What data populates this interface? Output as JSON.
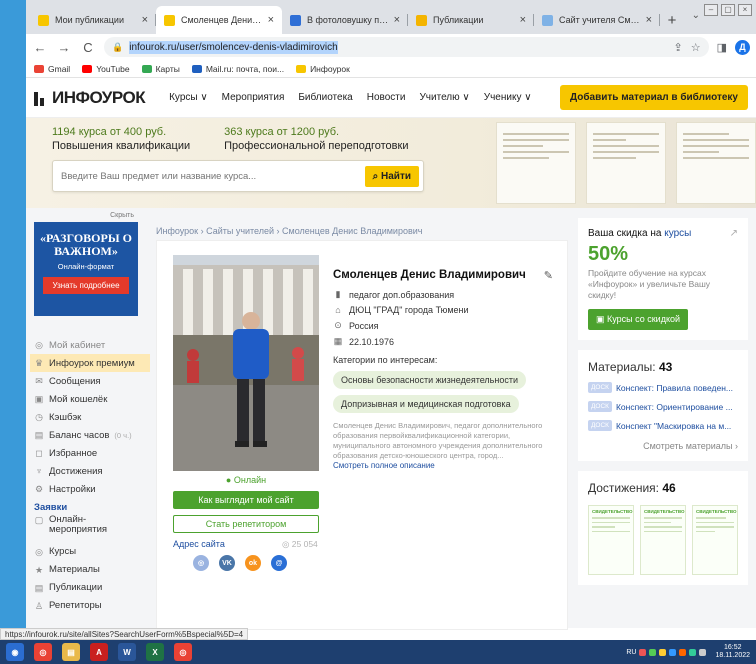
{
  "browser": {
    "tabs": [
      {
        "title": "Мои публикации",
        "color": "#f7c600",
        "active": false
      },
      {
        "title": "Смоленцев Денис Владимирович",
        "color": "#f7c600",
        "active": true
      },
      {
        "title": "В фотоловушку приморск",
        "color": "#2f6fd6",
        "active": false
      },
      {
        "title": "Публикации",
        "color": "#f4b400",
        "active": false
      },
      {
        "title": "Сайт учителя Смоленцев",
        "color": "#7fb2e6",
        "active": false
      }
    ],
    "new_tab": "+",
    "url": "infourok.ru/user/smolencev-denis-vladimirovich",
    "profile_initial": "Д",
    "bookmarks": [
      {
        "label": "Gmail",
        "color": "#ea4335"
      },
      {
        "label": "YouTube",
        "color": "#ff0000"
      },
      {
        "label": "Карты",
        "color": "#34a853"
      },
      {
        "label": "Mail.ru: почта, пои...",
        "color": "#1f5fbf"
      },
      {
        "label": "Инфоурок",
        "color": "#f7c600"
      }
    ]
  },
  "site": {
    "logo": "ИНФОУРОК",
    "nav": [
      "Курсы ∨",
      "Мероприятия",
      "Библиотека",
      "Новости",
      "Учителю ∨",
      "Ученику ∨"
    ],
    "add_button": "Добавить материал в библиотеку"
  },
  "banner": {
    "promo1_a": "1194 курса от 400 руб.",
    "promo1_b": "Повышения квалификации",
    "promo2_a": "363 курса от 1200 руб.",
    "promo2_b": "Профессиональной переподготовки",
    "search_placeholder": "Введите Ваш предмет или название курса...",
    "search_button": "⌕ Найти"
  },
  "ad": {
    "hide": "Скрыть",
    "title": "«РАЗГОВОРЫ О ВАЖНОМ»",
    "subtitle": "Онлайн-формат",
    "button": "Узнать подробнее"
  },
  "menu": {
    "items": [
      {
        "label": "Мой кабинет",
        "icon": "◎",
        "muted": true
      },
      {
        "label": "Инфоурок премиум",
        "icon": "♛",
        "premium": true
      },
      {
        "label": "Сообщения",
        "icon": "✉"
      },
      {
        "label": "Мой кошелёк",
        "icon": "▣"
      },
      {
        "label": "Кэшбэк",
        "icon": "◷"
      },
      {
        "label": "Баланс часов",
        "icon": "▤",
        "extra": "(0 ч.)"
      },
      {
        "label": "Избранное",
        "icon": "◻"
      },
      {
        "label": "Достижения",
        "icon": "♆"
      },
      {
        "label": "Настройки",
        "icon": "⚙"
      }
    ],
    "group": "Заявки",
    "group_items": [
      {
        "label": "Онлайн-мероприятия",
        "icon": "▢"
      },
      {
        "label": "Курсы",
        "icon": "◎"
      },
      {
        "label": "Материалы",
        "icon": "★"
      },
      {
        "label": "Публикации",
        "icon": "▤"
      },
      {
        "label": "Репетиторы",
        "icon": "♙"
      }
    ]
  },
  "breadcrumbs": "Инфоурок › Сайты учителей › Смоленцев Денис Владимирович",
  "profile": {
    "name": "Смоленцев Денис Владимирович",
    "position": "педагог доп.образования",
    "org": "ДЮЦ \"ГРАД\" города Тюмени",
    "country": "Россия",
    "birthday": "22.10.1976",
    "categories_label": "Категории по интересам:",
    "categories": [
      "Основы безопасности жизнедеятельности",
      "Допризывная и медицинская подготовка"
    ],
    "about": "Смоленцев Денис Владимирович, педагог дополнительного образования первойквалификационной категории, муниципального автономного учреждения дополнительного образования детско-юношеского центра, город...",
    "more_link": "Смотреть полное описание",
    "status": "● Онлайн",
    "btn_site": "Как выглядит мой сайт",
    "btn_tutor": "Стать репетитором",
    "site_address": "Адрес сайта",
    "views": "◎ 25 054"
  },
  "discount": {
    "heading": "Ваша скидка на",
    "heading_link": "курсы",
    "percent": "50%",
    "desc": "Пройдите обучение на курсах «Инфоурок» и увеличьте Вашу скидку!",
    "button": "▣ Курсы со скидкой"
  },
  "materials": {
    "label": "Материалы:",
    "count": "43",
    "items": [
      {
        "tag": "ДОСК",
        "title": "Конспект: Правила поведен..."
      },
      {
        "tag": "ДОСК",
        "title": "Конспект: Ориентирование ..."
      },
      {
        "tag": "ДОСК",
        "title": "Конспект \"Маскировка на м..."
      }
    ],
    "all": "Смотреть материалы ›"
  },
  "achievements": {
    "label": "Достижения:",
    "count": "46",
    "thumb_caption": "СВИДЕТЕЛЬСТВО"
  },
  "status_url": "https://infourok.ru/site/allSites?SearchUserForm%5Bspecial%5D=4",
  "taskbar": {
    "apps": [
      {
        "name": "start",
        "color": "#2b6dd1",
        "glyph": "◉"
      },
      {
        "name": "chrome",
        "color": "#e94235",
        "glyph": "◎"
      },
      {
        "name": "explorer",
        "color": "#e9b94a",
        "glyph": "▤"
      },
      {
        "name": "acrobat",
        "color": "#c9201f",
        "glyph": "A"
      },
      {
        "name": "word",
        "color": "#2a5699",
        "glyph": "W"
      },
      {
        "name": "excel",
        "color": "#1f7244",
        "glyph": "X"
      },
      {
        "name": "chrome2",
        "color": "#e94235",
        "glyph": "◎"
      }
    ],
    "lang": "RU",
    "time": "16:52",
    "date": "18.11.2022"
  }
}
